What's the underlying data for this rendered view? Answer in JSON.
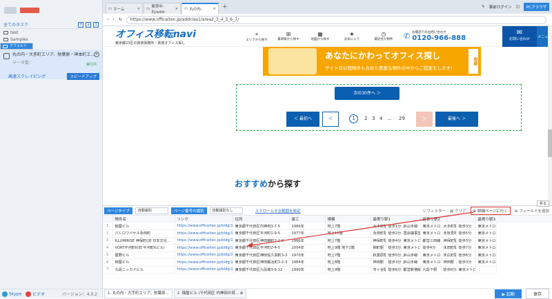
{
  "left": {
    "all_tasks": "全てのタスク",
    "folders": [
      "test",
      "Samples"
    ],
    "default_folder": "デフォルト",
    "task_title": "丸の内・大手町エリア、秋葉原・神本町エ...",
    "task_sub": "データ数:",
    "task_status": "実行中",
    "task_mode": "高速スクレイピング",
    "speed_up": "スピードアップ",
    "skype": "Skype",
    "video": "ビデオ",
    "version": "バージョン：4.0.2"
  },
  "browser": {
    "tabs": [
      "ホーム",
      "賃貸中-丸/addr",
      "丸の内-"
    ],
    "login": "事前ログイン",
    "pc_browser": "PCブラウザ",
    "url": "https://www.officeiten.jp/addr/aa1/area2_3_4_5_6_7/"
  },
  "site": {
    "logo": "オフィス移転navi",
    "logo_sub": "東京都23区の賃貸事務所・賃貸オフィス探し",
    "nav": [
      "エリアから探す",
      "最寄駅から探す",
      "地図から探す",
      "お気に入り",
      "最近見た物件"
    ],
    "phone_label": "お電話でのお問い合わせ",
    "phone": "0120-966-888",
    "mail": "お問い合わせ",
    "menu": "メニュー",
    "banner_title": "あなたにかわってオフィス探し",
    "banner_sub": "サイト非公開物件も含めた豊富な物件の中からご提案をします！",
    "banner_side": "相談",
    "next30": "次の30件へ ＞",
    "first": "＜ 最初へ",
    "prev": "＜",
    "pages": [
      "1",
      "2",
      "3",
      "4",
      "...",
      "29"
    ],
    "next": "＞",
    "last": "最後へ ＞",
    "recommend_a": "おすすめ",
    "recommend_b": "から探す"
  },
  "panel": {
    "collapse": "折る",
    "page_type_label": "ページタイプ",
    "page_type_val": "自動識別",
    "page_no_label": "ページ番号の識別",
    "page_no_val": "自動識別なし",
    "scroll_range": "スクロールする範囲を設定",
    "filter": "フィルター",
    "clear": "クリア",
    "detail": "詳細ページに行く",
    "add_field": "フィールドを追加",
    "columns": [
      "物件名",
      "リンク",
      "住所",
      "竣工",
      "規模",
      "最寄り駅1",
      "最寄り駅2",
      "最寄り駅3"
    ],
    "rows": [
      [
        "稲屋ビル",
        "https://www.officeiten.jp/bldg/130...",
        "東京都千代田区内神田3-7-5",
        "1966年",
        "地上7階",
        "大手町駅",
        "徒歩1分",
        "JR山手線"
      ],
      [
        "パレロワイヤル永田町",
        "https://www.officeiten.jp/bldg/130...",
        "東京都千代田区平河町1-9-5",
        "1977年",
        "地上11階",
        "永田町駅",
        "徒歩2分",
        "国会議事堂前"
      ],
      [
        "ILLUMIRISE 神保町(旧 日本文社...",
        "https://www.officeiten.jp/bldg/130...",
        "東京都千代田区神田錦町2-2-8",
        "1966年",
        "地上7階",
        "神保町駅",
        "徒歩4分",
        "東京メトロ"
      ],
      [
        "VORT平河町Ⅱ(旧 平河町Kビル)",
        "https://www.officeiten.jp/bldg/130...",
        "東京都千代田区平河町2-4-5",
        "2004年",
        "地上9階 地下1階",
        "麹町駅",
        "徒歩3分",
        "東京メトロ"
      ],
      [
        "屋野ビル",
        "https://www.officeiten.jp/bldg/130...",
        "東京都千代田区神田佐久間町3-3",
        "1970年",
        "地上7階",
        "秋葉原駅",
        "徒歩5分",
        "JR山手線"
      ],
      [
        "柳屋ビル",
        "https://www.officeiten.jp/bldg/130...",
        "東京都千代田区神田鍛冶町3-2-3",
        "1984年",
        "地上8階",
        "神田駅",
        "徒歩3分",
        "JR山手線"
      ],
      [
        "九段ニッカナビル",
        "https://www.officeiten.jp/bldg/130...",
        "東京都千代田区九段南3-9-12",
        "1990年",
        "地上9階",
        "市ヶ谷駅",
        "徒歩6分",
        "都営新宿線"
      ]
    ],
    "rows_extra": [
      [
        "東京メトロ",
        "大手町駅",
        "徒歩3分",
        "東京メトロ"
      ],
      [
        "東京メトロ",
        "赤坂見附駅",
        "徒歩5分",
        "東京メトロ"
      ],
      [
        "都営三田線",
        "神保町駅",
        "徒歩3分",
        "東京メトロ"
      ],
      [
        "徒歩4分",
        "永田町駅",
        "徒歩7分",
        "東京メトロ"
      ],
      [
        "東京メトロ",
        "末広町駅",
        "徒歩6分",
        "東京メトロ"
      ],
      [
        "東京メトロ",
        "神田駅",
        "徒歩3分",
        "東京メトロ"
      ],
      [
        "九段下駅",
        "徒歩8分",
        "東京メトロ",
        ""
      ]
    ],
    "btab1": "1. 丸の内・大手町エリア、秋葉原...",
    "btab2": "2. 稲屋ビル (千代田区 内神田の貸...",
    "run": "▶ 起動",
    "save": "保存"
  }
}
